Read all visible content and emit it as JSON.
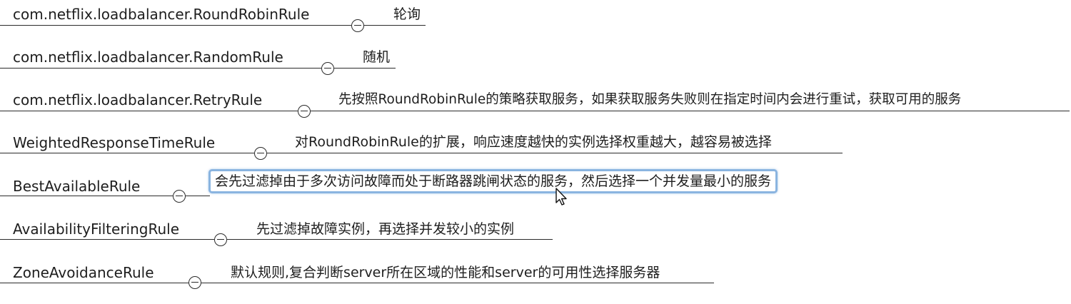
{
  "rules": [
    {
      "name": "com.netflix.loadbalancer.RoundRobinRule",
      "description": "轮询"
    },
    {
      "name": "com.netflix.loadbalancer.RandomRule",
      "description": "随机"
    },
    {
      "name": "com.netflix.loadbalancer.RetryRule",
      "description": "先按照RoundRobinRule的策略获取服务，如果获取服务失败则在指定时间内会进行重试，获取可用的服务"
    },
    {
      "name": "WeightedResponseTimeRule",
      "description": "对RoundRobinRule的扩展，响应速度越快的实例选择权重越大，越容易被选择"
    },
    {
      "name": "BestAvailableRule",
      "description": "会先过滤掉由于多次访问故障而处于断路器跳闸状态的服务，然后选择一个并发量最小的服务"
    },
    {
      "name": "AvailabilityFilteringRule",
      "description": "先过滤掉故障实例，再选择并发较小的实例"
    },
    {
      "name": "ZoneAvoidanceRule",
      "description": "默认规则,复合判断server所在区域的性能和server的可用性选择服务器"
    }
  ]
}
